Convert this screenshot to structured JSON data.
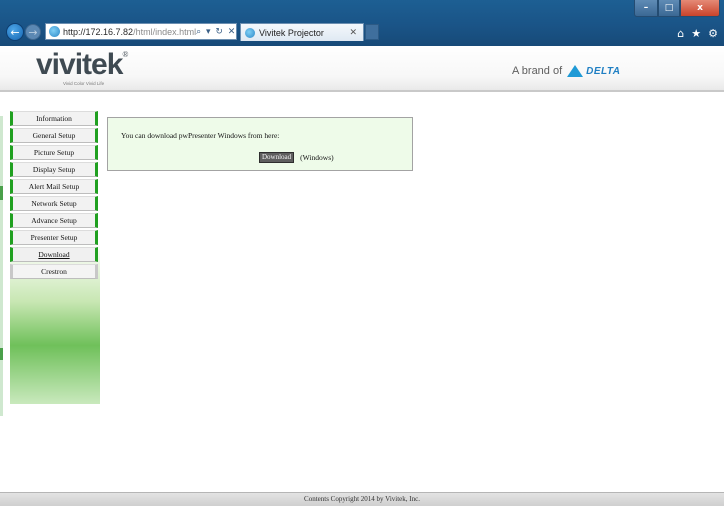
{
  "browser": {
    "url_host": "http://172.16.7.82",
    "url_path": "/html/index.html",
    "addr_tools": "⌕ ▾ ↻ ✕",
    "tab_title": "Vivitek Projector",
    "tab_close": "✕",
    "back_glyph": "←",
    "forward_glyph": "→",
    "window_min": "–",
    "window_max": "□",
    "window_close": "x",
    "tool_home": "⌂",
    "tool_favorites": "★",
    "tool_settings": "⚙"
  },
  "header": {
    "logo_text": "vivitek",
    "logo_registered": "®",
    "logo_tagline": "Vivid Color Vivid Life",
    "brand_prefix": "A brand of",
    "brand_name": "DELTA"
  },
  "sidebar": {
    "items": [
      {
        "label": "Information"
      },
      {
        "label": "General Setup"
      },
      {
        "label": "Picture Setup"
      },
      {
        "label": "Display Setup"
      },
      {
        "label": "Alert Mail Setup"
      },
      {
        "label": "Network Setup"
      },
      {
        "label": "Advance Setup"
      },
      {
        "label": "Presenter Setup"
      },
      {
        "label": "Download"
      },
      {
        "label": "Crestron"
      }
    ],
    "active": "Download"
  },
  "content": {
    "message": "You can download pwPresenter Windows from here:",
    "download_label": "Download",
    "download_os": "(Windows)"
  },
  "footer": {
    "text": "Contents Copyright 2014 by Vivitek, Inc."
  },
  "colors": {
    "menu_accent": "#20a020",
    "content_bg": "#eefbe9",
    "chrome_blue": "#1a5487"
  }
}
